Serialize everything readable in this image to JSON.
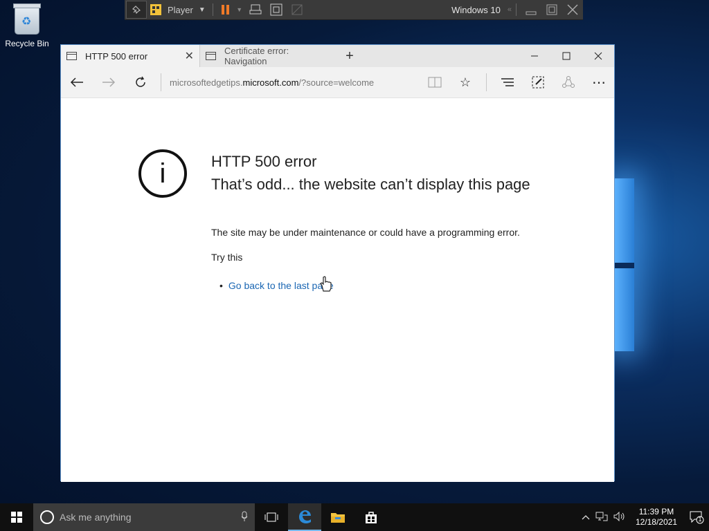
{
  "desktop": {
    "recycle_bin_label": "Recycle Bin"
  },
  "player_bar": {
    "menu_label": "Player",
    "vm_name": "Windows 10",
    "pause_color": "#f07a28"
  },
  "browser": {
    "tabs": [
      {
        "label": "HTTP 500 error",
        "active": true
      },
      {
        "label": "Certificate error: Navigation",
        "active": false
      }
    ],
    "address": {
      "prefix": "microsoftedgetips.",
      "domain": "microsoft.com",
      "suffix": "/?source=welcome"
    },
    "page": {
      "title": "HTTP 500 error",
      "heading": "That’s odd... the website can’t display this page",
      "description": "The site may be under maintenance or could have a programming error.",
      "try_label": "Try this",
      "link_label": "Go back to the last page"
    },
    "link_color": "#1a66b3"
  },
  "taskbar": {
    "search_placeholder": "Ask me anything",
    "time": "11:39 PM",
    "date": "12/18/2021",
    "notification_count": "1"
  },
  "icons": [
    "recycle-bin-icon",
    "pin-icon",
    "player-icon",
    "pause-icon",
    "send-ctrl-alt-del-icon",
    "fullscreen-icon",
    "unity-icon",
    "back-icon",
    "forward-icon",
    "refresh-icon",
    "reading-view-icon",
    "favorite-star-icon",
    "hub-icon",
    "web-note-icon",
    "share-icon",
    "more-icon",
    "info-icon",
    "start-icon",
    "cortana-icon",
    "microphone-icon",
    "task-view-icon",
    "edge-icon",
    "file-explorer-icon",
    "store-icon",
    "chevron-up-icon",
    "network-icon",
    "volume-icon",
    "action-center-icon"
  ]
}
